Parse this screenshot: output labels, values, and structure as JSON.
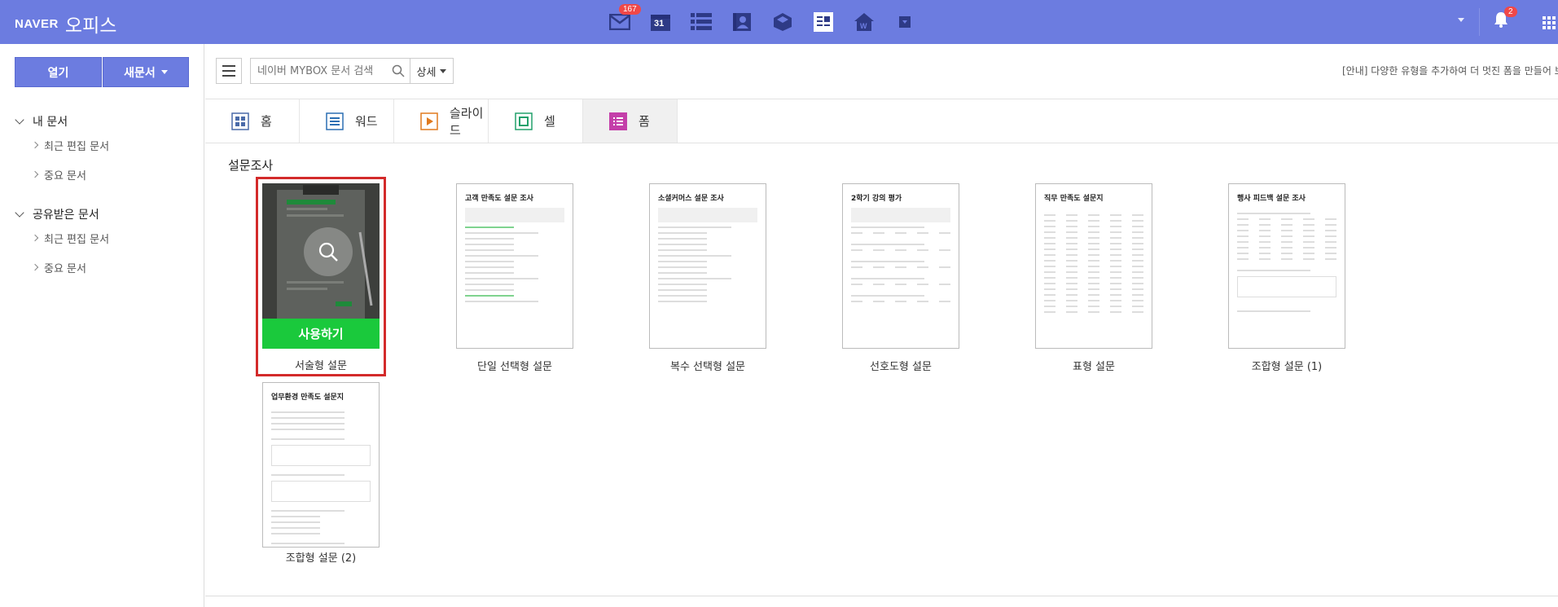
{
  "header": {
    "brand": "NAVER",
    "product": "오피스",
    "mail_count": "167",
    "calendar_day": "31",
    "notification_count": "2",
    "icons": [
      "mail-icon",
      "calendar-icon",
      "list-icon",
      "contacts-icon",
      "cube-icon",
      "memo-icon",
      "home-icon",
      "more-icon"
    ]
  },
  "sidebar": {
    "open_label": "열기",
    "new_label": "새문서",
    "groups": [
      {
        "label": "내 문서",
        "items": [
          "최근 편집 문서",
          "중요 문서"
        ]
      },
      {
        "label": "공유받은 문서",
        "items": [
          "최근 편집 문서",
          "중요 문서"
        ]
      }
    ]
  },
  "toolbar": {
    "search_placeholder": "네이버 MYBOX 문서 검색",
    "detail_label": "상세",
    "notice": "[안내] 다양한 유형을 추가하여 더 멋진 폼을 만들어 보세요"
  },
  "tabs": [
    {
      "label": "홈",
      "icon": "home-grid-icon",
      "color": "#4a6aa8"
    },
    {
      "label": "워드",
      "icon": "word-icon",
      "color": "#2c6fb3"
    },
    {
      "label": "슬라이드",
      "icon": "slide-icon",
      "color": "#e07a1f"
    },
    {
      "label": "셀",
      "icon": "cell-icon",
      "color": "#22a06b"
    },
    {
      "label": "폼",
      "icon": "form-icon",
      "color": "#c43fa9",
      "active": true
    }
  ],
  "section": {
    "title": "설문조사",
    "use_button": "사용하기",
    "templates": [
      {
        "label": "서술형 설문",
        "thumb_title": "",
        "selected": true
      },
      {
        "label": "단일 선택형 설문",
        "thumb_title": "고객 만족도 설문 조사"
      },
      {
        "label": "복수 선택형 설문",
        "thumb_title": "소셜커머스 설문 조사"
      },
      {
        "label": "선호도형 설문",
        "thumb_title": "2학기 강의 평가"
      },
      {
        "label": "표형 설문",
        "thumb_title": "직무 만족도 설문지"
      },
      {
        "label": "조합형 설문 (1)",
        "thumb_title": "행사 피드백 설문 조사"
      },
      {
        "label": "조합형 설문 (2)",
        "thumb_title": "업무환경 만족도 설문지"
      }
    ]
  },
  "colors": {
    "topbar": "#6c7ce0",
    "accent_green": "#1ac93c",
    "selection_red": "#d32a2a",
    "badge_red": "#f04848"
  }
}
